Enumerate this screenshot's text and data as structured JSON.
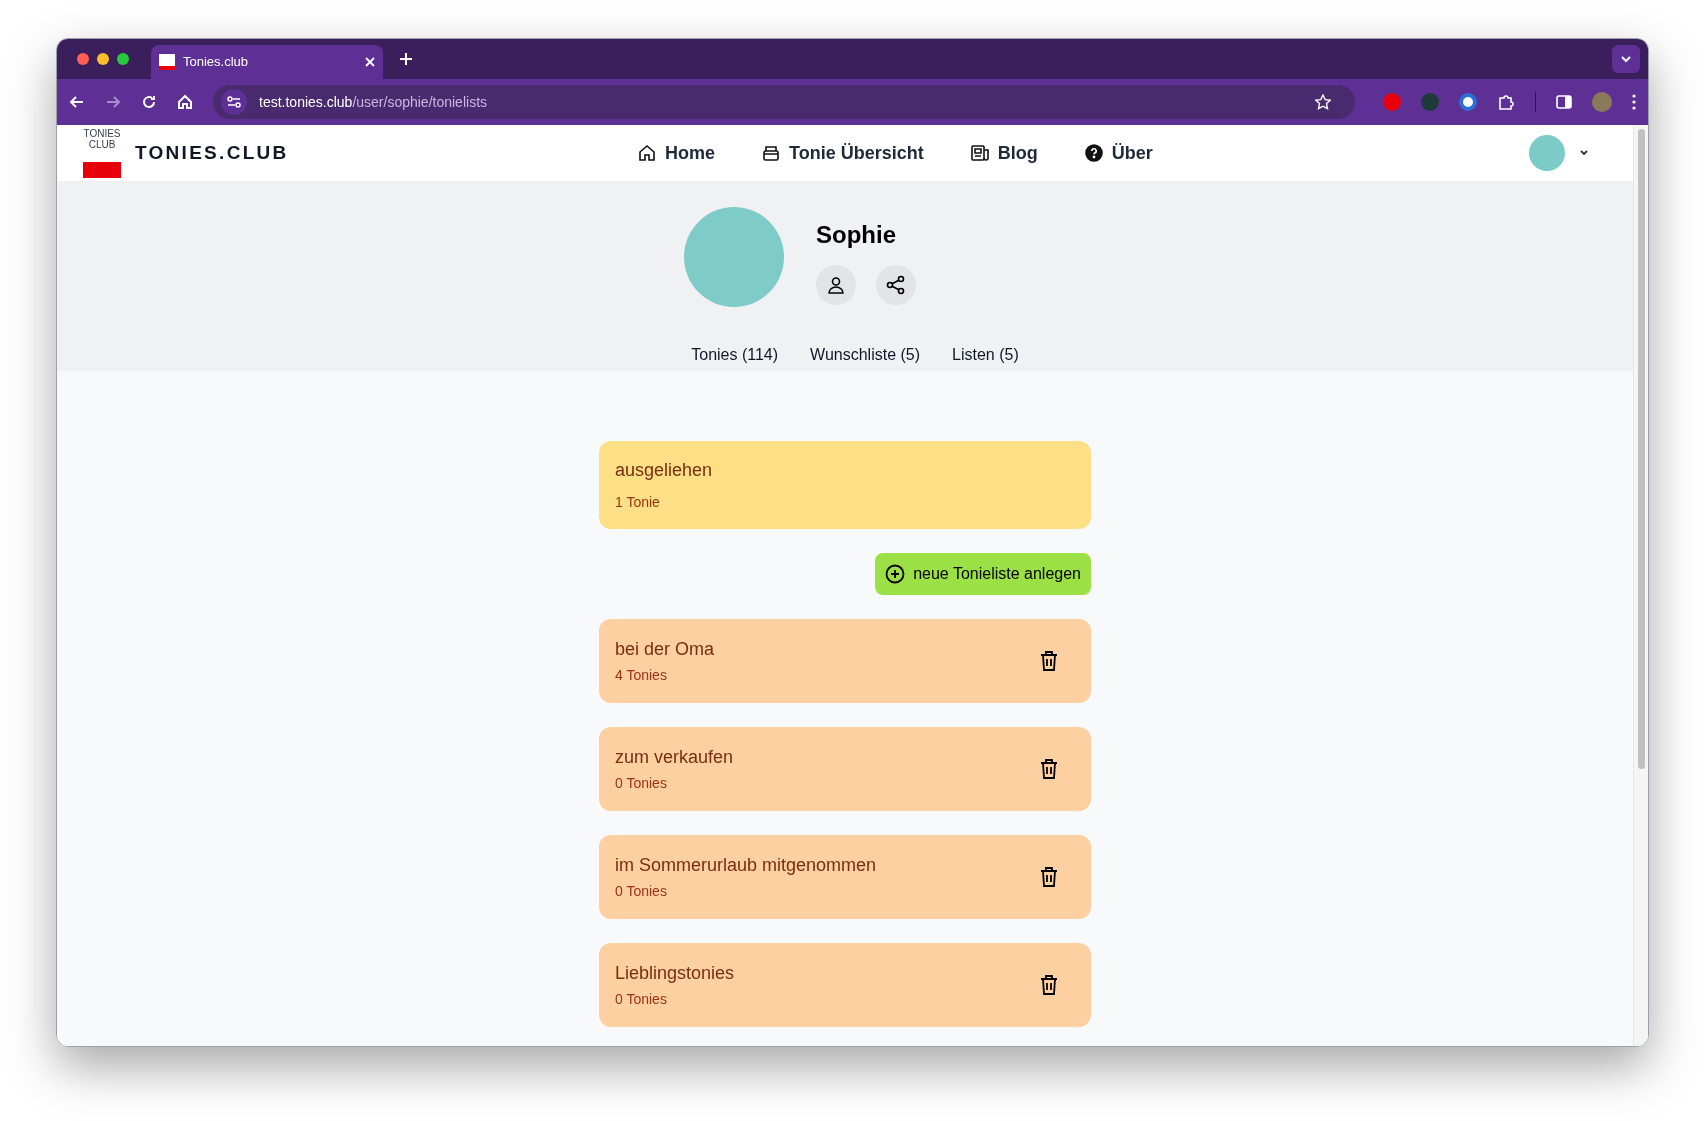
{
  "browser": {
    "tab_title": "Tonies.club",
    "url_host": "test.tonies.club",
    "url_path": "/user/sophie/tonielists"
  },
  "site": {
    "logo_text": "TONIES CLUB",
    "brand": "TONIES.CLUB",
    "nav": [
      {
        "label": "Home"
      },
      {
        "label": "Tonie Übersicht"
      },
      {
        "label": "Blog"
      },
      {
        "label": "Über"
      }
    ]
  },
  "profile": {
    "name": "Sophie",
    "tabs": [
      "Tonies (114)",
      "Wunschliste (5)",
      "Listen (5)"
    ]
  },
  "lists": [
    {
      "kind": "fixed",
      "title": "ausgeliehen",
      "count": "1 Tonie"
    },
    {
      "kind": "button",
      "label": "neue Tonieliste anlegen"
    },
    {
      "kind": "custom",
      "title": "bei der Oma",
      "count": "4 Tonies"
    },
    {
      "kind": "custom",
      "title": "zum verkaufen",
      "count": "0 Tonies"
    },
    {
      "kind": "custom",
      "title": "im Sommerurlaub mitgenommen",
      "count": "0 Tonies"
    },
    {
      "kind": "custom",
      "title": "Lieblingstonies",
      "count": "0 Tonies"
    }
  ]
}
